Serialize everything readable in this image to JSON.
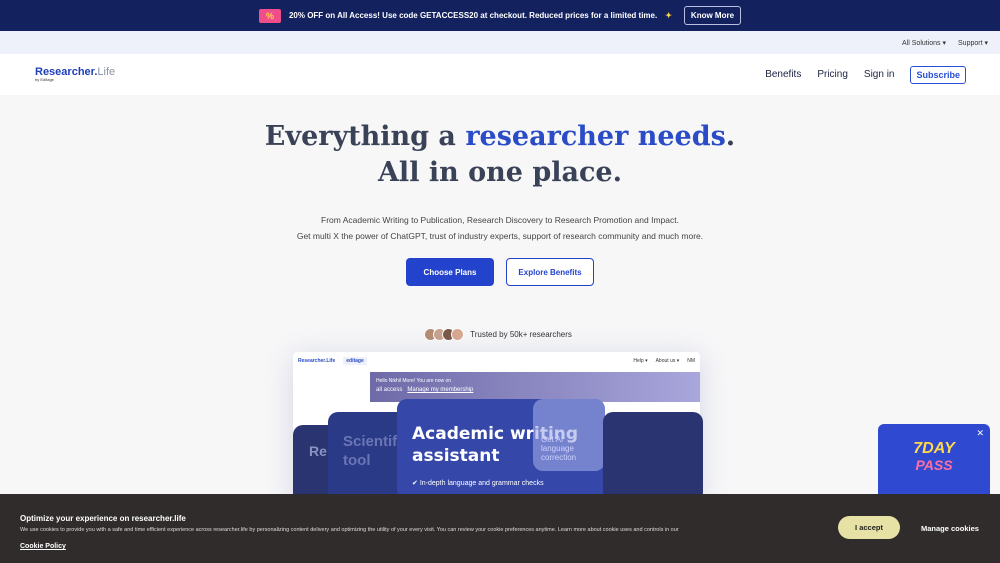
{
  "promo": {
    "icon": "ticket-percent-icon",
    "text": "20% OFF on All Access! Use code GETACCESS20 at checkout. Reduced prices for a limited time.",
    "sparkle": "sparkle-icon",
    "button": "Know More"
  },
  "utility": {
    "items": [
      "All Solutions ▾",
      "Support ▾"
    ]
  },
  "nav": {
    "logo_main": "Researcher.",
    "logo_suffix": "Life",
    "logo_by": "by Editage",
    "links": [
      "Benefits",
      "Pricing",
      "Sign in"
    ],
    "subscribe": "Subscribe"
  },
  "hero": {
    "title_a": "Everything a ",
    "title_highlight": "researcher needs",
    "title_b": ".",
    "title_line2": "All in one place.",
    "desc1": "From Academic Writing to Publication, Research Discovery to Research Promotion and Impact.",
    "desc2": "Get multi X the power of ChatGPT, trust of industry experts, support of research community and much more.",
    "primary": "Choose Plans",
    "secondary": "Explore Benefits",
    "trusted": "Trusted by 50k+ researchers"
  },
  "preview": {
    "logo": "Researcher.Life",
    "partner": "editage",
    "help": "Help ▾",
    "about": "About us ▾",
    "user": "NM",
    "greeting": "Hello Nikhil More! You are now on",
    "plan": "all access",
    "manage": "Manage my membership",
    "card_title": "Academic writing assistant",
    "card_point": "In-depth language and grammar checks",
    "side_card": "Get AI language correction",
    "left_card": "Scientific tool",
    "left_card2": "Re"
  },
  "pass": {
    "line1": "7DAY",
    "line2": "PASS"
  },
  "cookie": {
    "title": "Optimize your experience on researcher.life",
    "body": "We use cookies to provide you with a safe and time efficient experience across researcher.life by personalizing content delivery and optimizing the utility of your every visit. You can review your cookie preferences anytime. Learn more about cookie uses and controls in our",
    "link": "Cookie Policy",
    "accept": "I accept",
    "manage": "Manage cookies"
  },
  "colors": {
    "promo_bg": "#13225f",
    "brand": "#2343cc",
    "cookie_bg": "#302c2c",
    "accept_bg": "#e6e2a6"
  }
}
